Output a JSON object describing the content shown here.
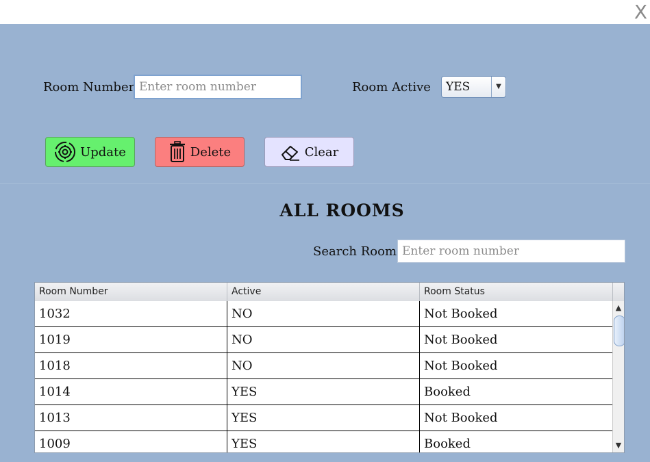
{
  "window": {
    "close_label": "X"
  },
  "form": {
    "room_number_label": "Room Number",
    "room_number_placeholder": "Enter room number",
    "room_number_value": "",
    "room_active_label": "Room Active",
    "room_active_value": "YES"
  },
  "buttons": {
    "update": "Update",
    "delete": "Delete",
    "clear": "Clear"
  },
  "section": {
    "heading": "ALL ROOMS",
    "search_label": "Search Room",
    "search_placeholder": "Enter room number"
  },
  "table": {
    "columns": [
      "Room Number",
      "Active",
      "Room Status"
    ],
    "rows": [
      [
        "1032",
        "NO",
        "Not Booked"
      ],
      [
        "1019",
        "NO",
        "Not Booked"
      ],
      [
        "1018",
        "NO",
        "Not Booked"
      ],
      [
        "1014",
        "YES",
        "Booked"
      ],
      [
        "1013",
        "YES",
        "Not Booked"
      ],
      [
        "1009",
        "YES",
        "Booked"
      ]
    ]
  },
  "icons": {
    "update": "settings-refresh-icon",
    "delete": "trash-icon",
    "clear": "eraser-icon"
  },
  "colors": {
    "panel_bg": "#99b2d1",
    "update_bg": "#66f06e",
    "delete_bg": "#fb7f7f",
    "clear_bg": "#e4e3ff"
  }
}
